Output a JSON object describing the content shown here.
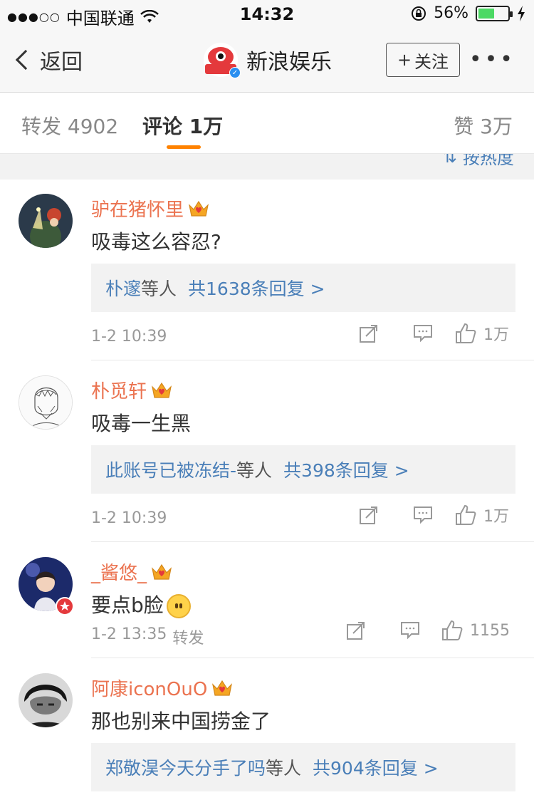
{
  "status_bar": {
    "carrier": "中国联通",
    "time": "14:32",
    "battery_percent": "56%",
    "battery_level": 0.56
  },
  "nav": {
    "back_label": "返回",
    "title": "新浪娱乐",
    "follow_label": "关注",
    "more_label": "•••"
  },
  "tabs": {
    "repost": "转发 4902",
    "comment": "评论 1万",
    "like": "赞 3万"
  },
  "sort_label": "按热度",
  "comments": [
    {
      "username": "驴在猪怀里",
      "text": "吸毒这么容忍?",
      "reply_users": "朴邃",
      "reply_suffix": "等人",
      "reply_count": "共1638条回复 >",
      "time": "1-2 10:39",
      "extra": "",
      "likes": "1万"
    },
    {
      "username": "朴觅轩",
      "text": "吸毒一生黑",
      "reply_users": "此账号已被冻结-",
      "reply_suffix": "等人",
      "reply_count": "共398条回复 >",
      "time": "1-2 10:39",
      "extra": "",
      "likes": "1万"
    },
    {
      "username": "_酱悠_",
      "text": "要点b脸",
      "time": "1-2 13:35",
      "extra": "转发",
      "likes": "1155"
    },
    {
      "username": "阿康iconOuO",
      "text": "那也别来中国捞金了",
      "reply_users": "郑敬淏今天分手了吗",
      "reply_suffix": "等人",
      "reply_count": "共904条回复 >"
    }
  ],
  "colors": {
    "username": "#eb7350",
    "link": "#4a7fb8",
    "accent": "#ff8200"
  }
}
